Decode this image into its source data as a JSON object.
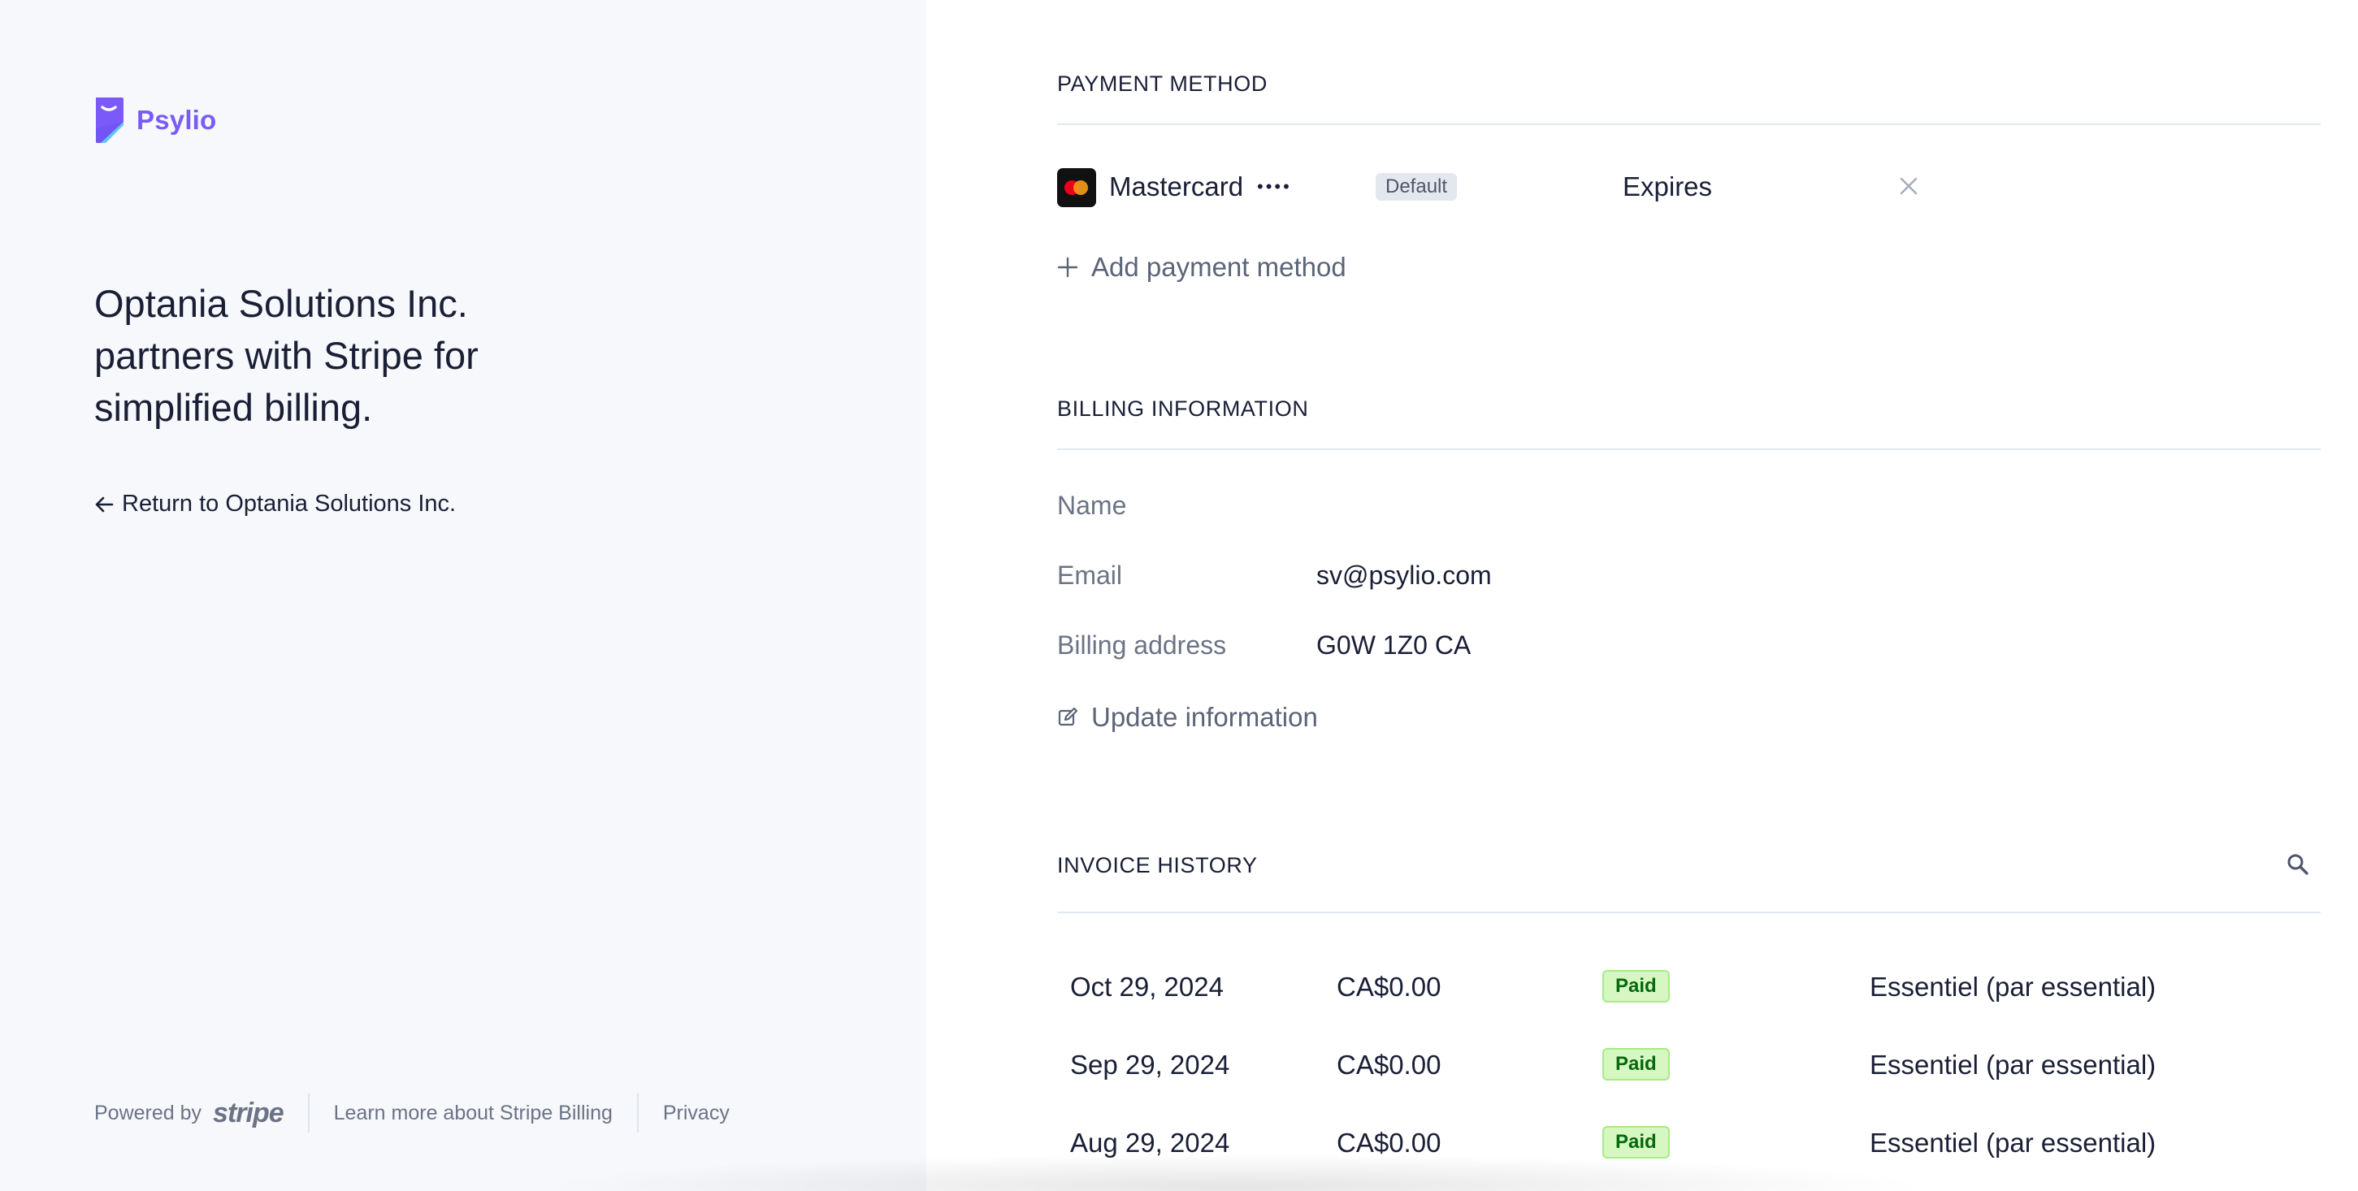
{
  "brand": {
    "name": "Psylio",
    "color": "#7a5af8"
  },
  "left": {
    "headline_lines": [
      "Optania Solutions Inc.",
      "partners with Stripe for",
      "simplified billing."
    ],
    "return_link": "Return to Optania Solutions Inc.",
    "return_icon": "arrow-left-icon"
  },
  "footer": {
    "powered_by": "Powered by",
    "stripe_logo": "stripe",
    "learn_more": "Learn more about Stripe Billing",
    "privacy": "Privacy"
  },
  "payment_method": {
    "title": "PAYMENT METHOD",
    "card": {
      "brand": "Mastercard",
      "masked": "••••",
      "default_badge": "Default",
      "expires_label": "Expires",
      "icon": "mastercard-icon",
      "remove_icon": "close-icon"
    },
    "add_label": "Add payment method",
    "add_icon": "plus-icon"
  },
  "billing": {
    "title": "BILLING INFORMATION",
    "name_label": "Name",
    "name_value": "",
    "email_label": "Email",
    "email_value": "sv@psylio.com",
    "address_label": "Billing address",
    "address_value": "G0W 1Z0 CA",
    "update_label": "Update information",
    "update_icon": "edit-icon"
  },
  "invoices": {
    "title": "INVOICE HISTORY",
    "search_icon": "search-icon",
    "paid_color": "#d7f7c2",
    "rows": [
      {
        "date": "Oct 29, 2024",
        "amount": "CA$0.00",
        "status": "Paid",
        "plan": "Essentiel (par essential)"
      },
      {
        "date": "Sep 29, 2024",
        "amount": "CA$0.00",
        "status": "Paid",
        "plan": "Essentiel (par essential)"
      },
      {
        "date": "Aug 29, 2024",
        "amount": "CA$0.00",
        "status": "Paid",
        "plan": "Essentiel (par essential)"
      }
    ]
  }
}
